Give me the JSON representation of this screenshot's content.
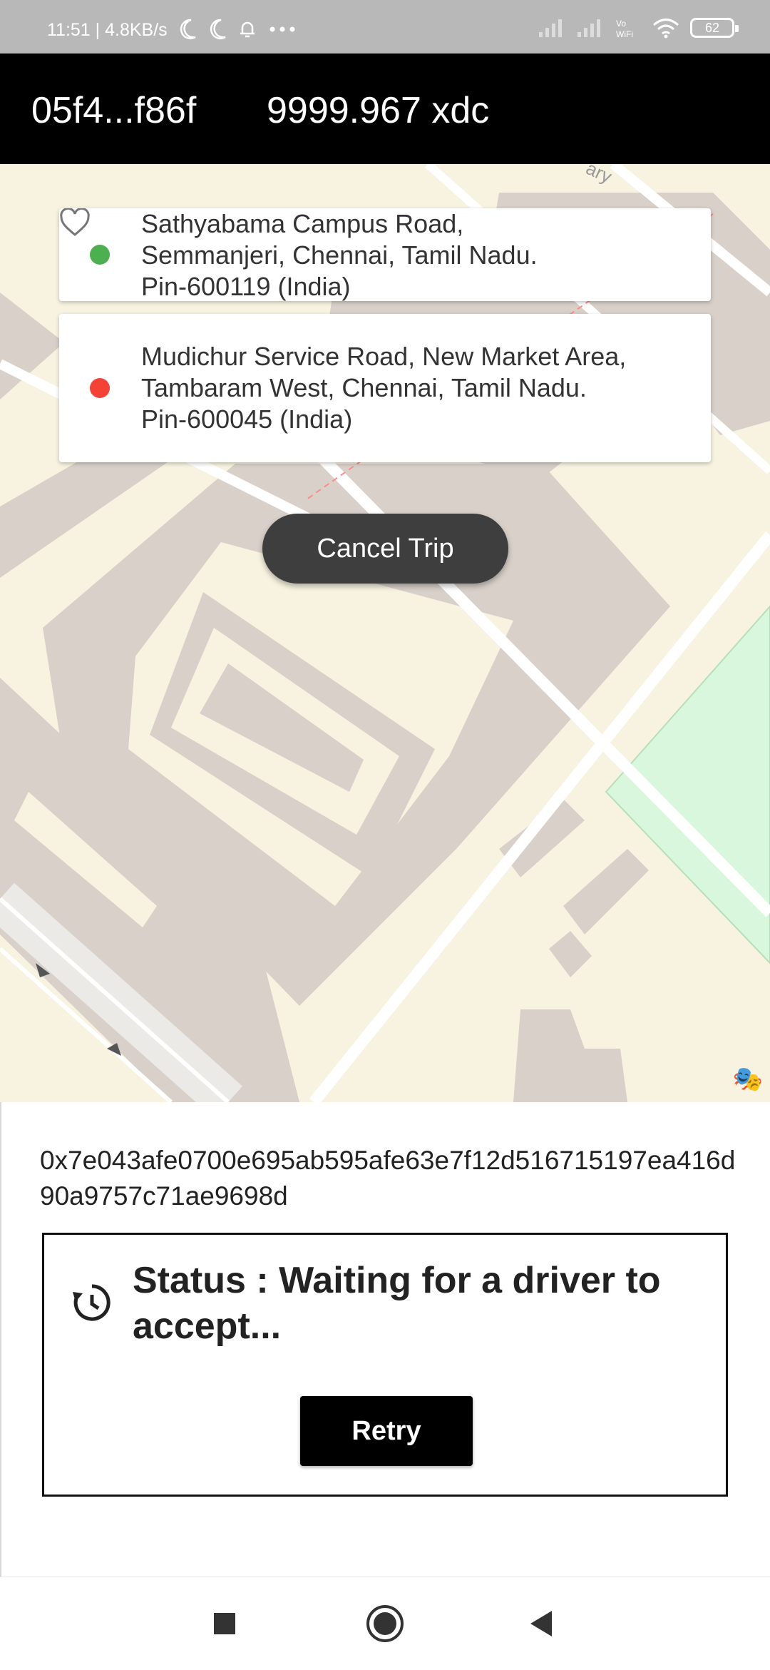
{
  "status_bar": {
    "time_speed": "11:51 | 4.8KB/s",
    "battery": "62",
    "icons": [
      "moon-icon",
      "moon-icon",
      "bell-icon",
      "more-dots-icon",
      "signal-icon",
      "signal-icon",
      "vowifi-icon",
      "wifi-icon",
      "battery-icon"
    ]
  },
  "header": {
    "wallet_address": "05f4...f86f",
    "balance": "9999.967 xdc"
  },
  "map": {
    "pickup": {
      "address": "Sathyabama Campus Road,\nSemmanjeri, Chennai, Tamil Nadu.\nPin-600119 (India)",
      "dot_color": "#4caf50"
    },
    "drop": {
      "address": "Mudichur Service Road, New Market Area,\nTambaram West, Chennai, Tamil Nadu.\nPin-600045 (India)",
      "dot_color": "#f44336"
    },
    "cancel_label": "Cancel Trip",
    "corner_label": "ary"
  },
  "trip": {
    "tx_hash": "0x7e043afe0700e695ab595afe63e7f12d516715197ea416d90a9757c71ae9698d",
    "status_text": "Status : Waiting for a driver to accept...",
    "retry_label": "Retry"
  },
  "colors": {
    "header_bg": "#000000",
    "map_bg": "#f8f3e1",
    "building": "#d9d0c9",
    "park": "#d8f7dc",
    "cancel_bg": "#3e3e3e"
  },
  "nav": {
    "buttons": [
      "recents-square-icon",
      "home-circle-icon",
      "back-triangle-icon"
    ]
  }
}
